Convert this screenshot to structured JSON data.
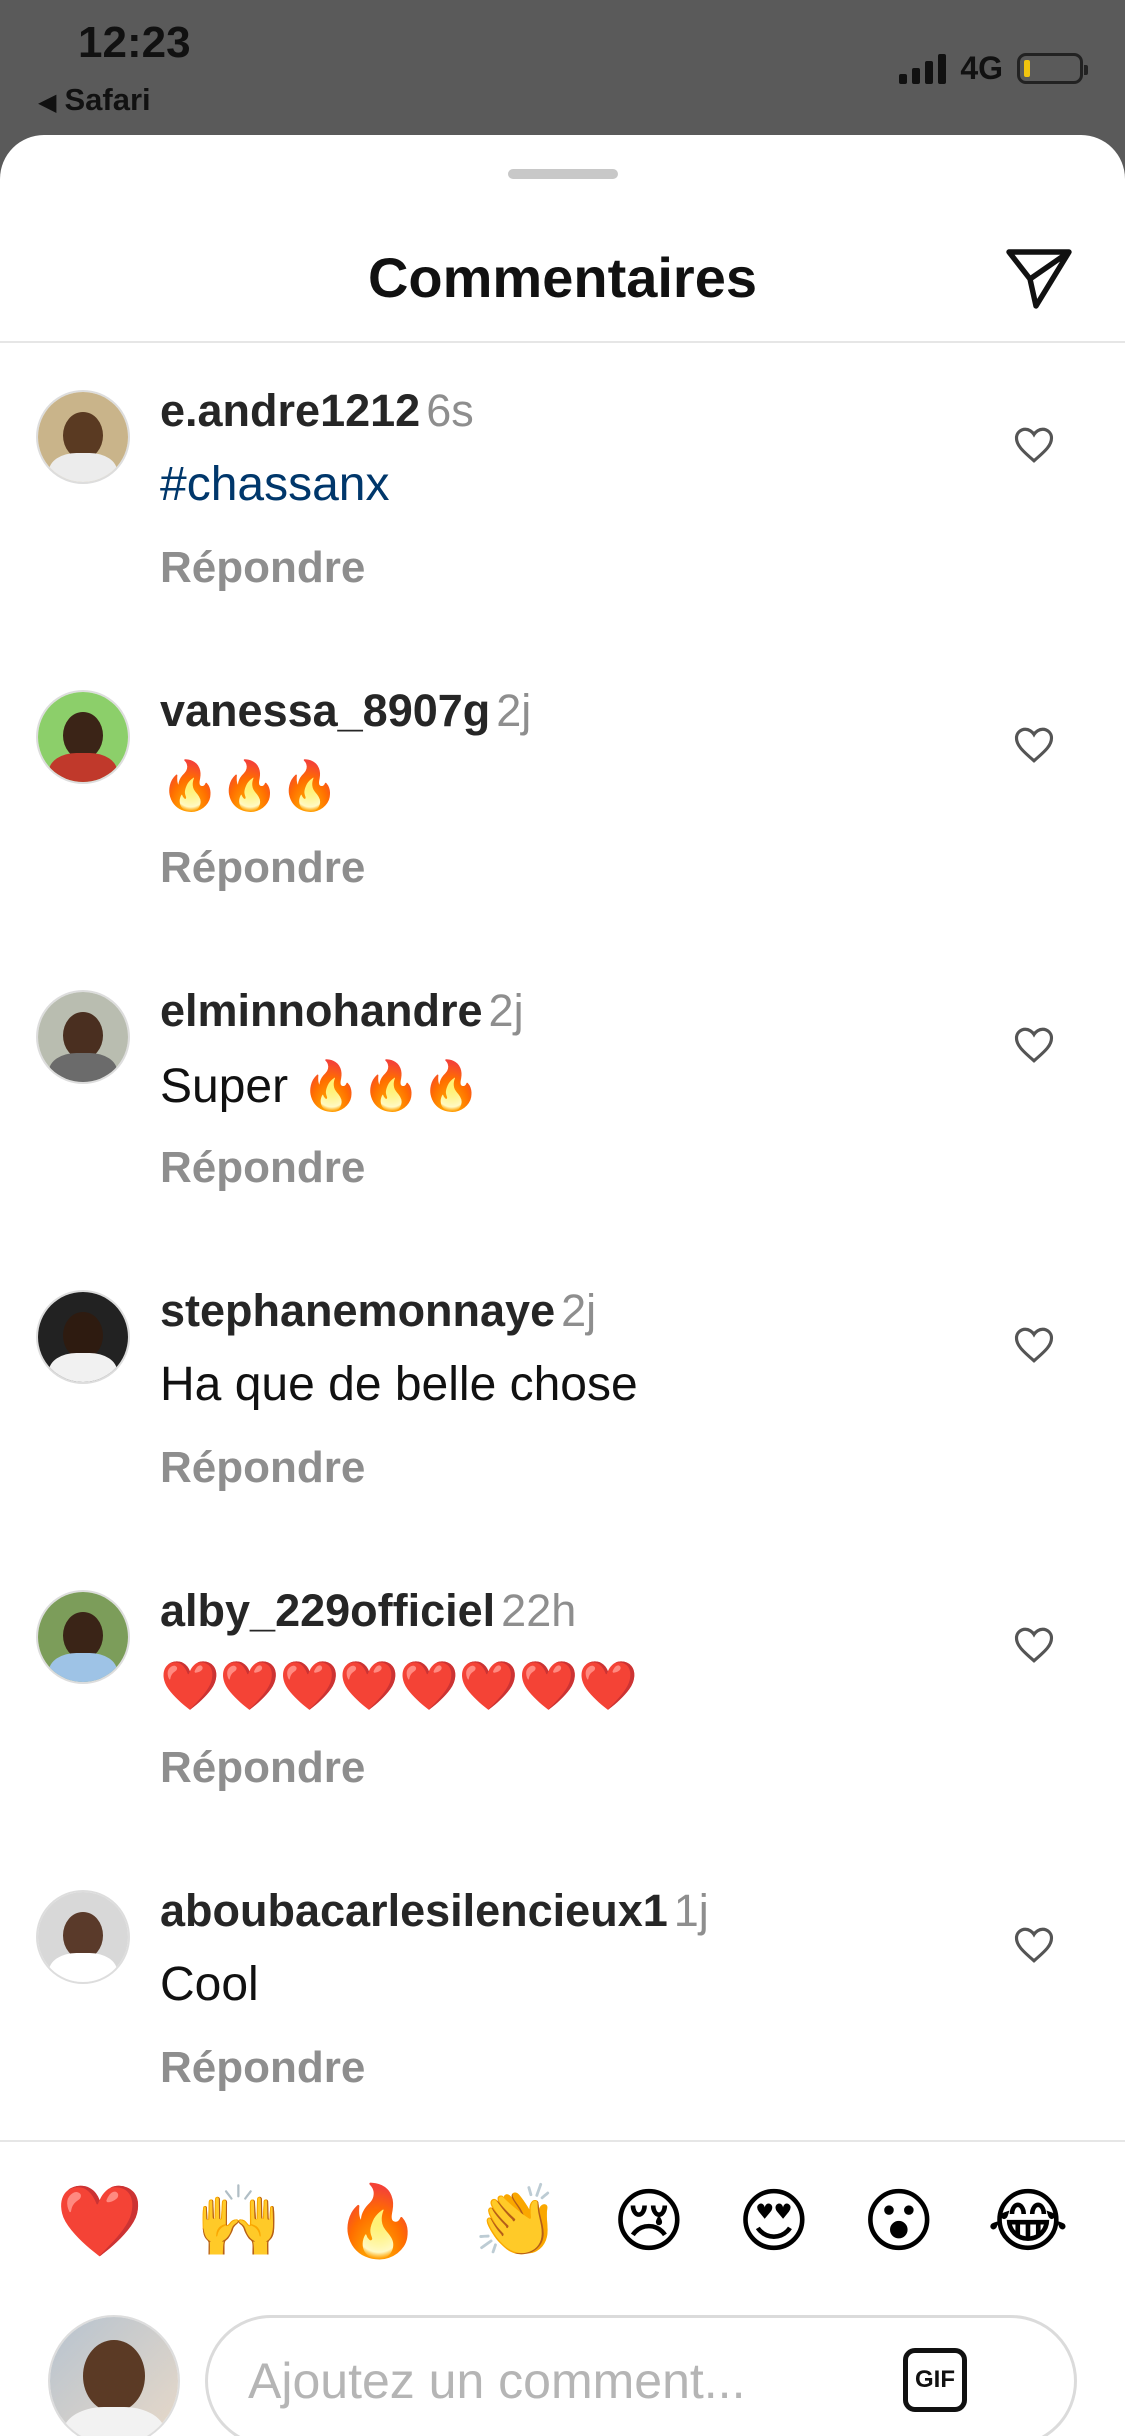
{
  "status_bar": {
    "time": "12:23",
    "back_app": "Safari",
    "network": "4G"
  },
  "header": {
    "title": "Commentaires"
  },
  "comments": [
    {
      "username": "e.andre1212",
      "time": "6s",
      "text": "#chassanx",
      "reply_label": "Répondre",
      "avatar_colors": {
        "bg": "#c9b48a",
        "face": "#5a3a22",
        "body": "#ececec"
      }
    },
    {
      "username": "vanessa_8907g",
      "time": "2j",
      "text": "🔥🔥🔥",
      "reply_label": "Répondre",
      "avatar_colors": {
        "bg": "#8ccf6a",
        "face": "#3b2417",
        "body": "#c0392b"
      }
    },
    {
      "username": "elminnohandre",
      "time": "2j",
      "text": "Super 🔥🔥🔥",
      "reply_label": "Répondre",
      "avatar_colors": {
        "bg": "#b9bdb0",
        "face": "#4a2f20",
        "body": "#6b6b6b"
      }
    },
    {
      "username": "stephanemonnaye",
      "time": "2j",
      "text": "Ha que de belle chose",
      "reply_label": "Répondre",
      "avatar_colors": {
        "bg": "#222222",
        "face": "#2e1b10",
        "body": "#f1f1f1"
      }
    },
    {
      "username": "alby_229officiel",
      "time": "22h",
      "text": "❤️❤️❤️❤️❤️❤️❤️❤️",
      "reply_label": "Répondre",
      "avatar_colors": {
        "bg": "#7c9d5a",
        "face": "#3a2417",
        "body": "#9ec3e6"
      }
    },
    {
      "username": "aboubacarlesilencieux1",
      "time": "1j",
      "text": "Cool",
      "reply_label": "Répondre",
      "avatar_colors": {
        "bg": "#d8d8d8",
        "face": "#5a3a2a",
        "body": "#ffffff"
      }
    }
  ],
  "reactions": [
    "❤️",
    "🙌",
    "🔥",
    "👏",
    "😢",
    "😍",
    "😮",
    "😂"
  ],
  "composer": {
    "placeholder": "Ajoutez un comment...",
    "gif_label": "GIF"
  }
}
